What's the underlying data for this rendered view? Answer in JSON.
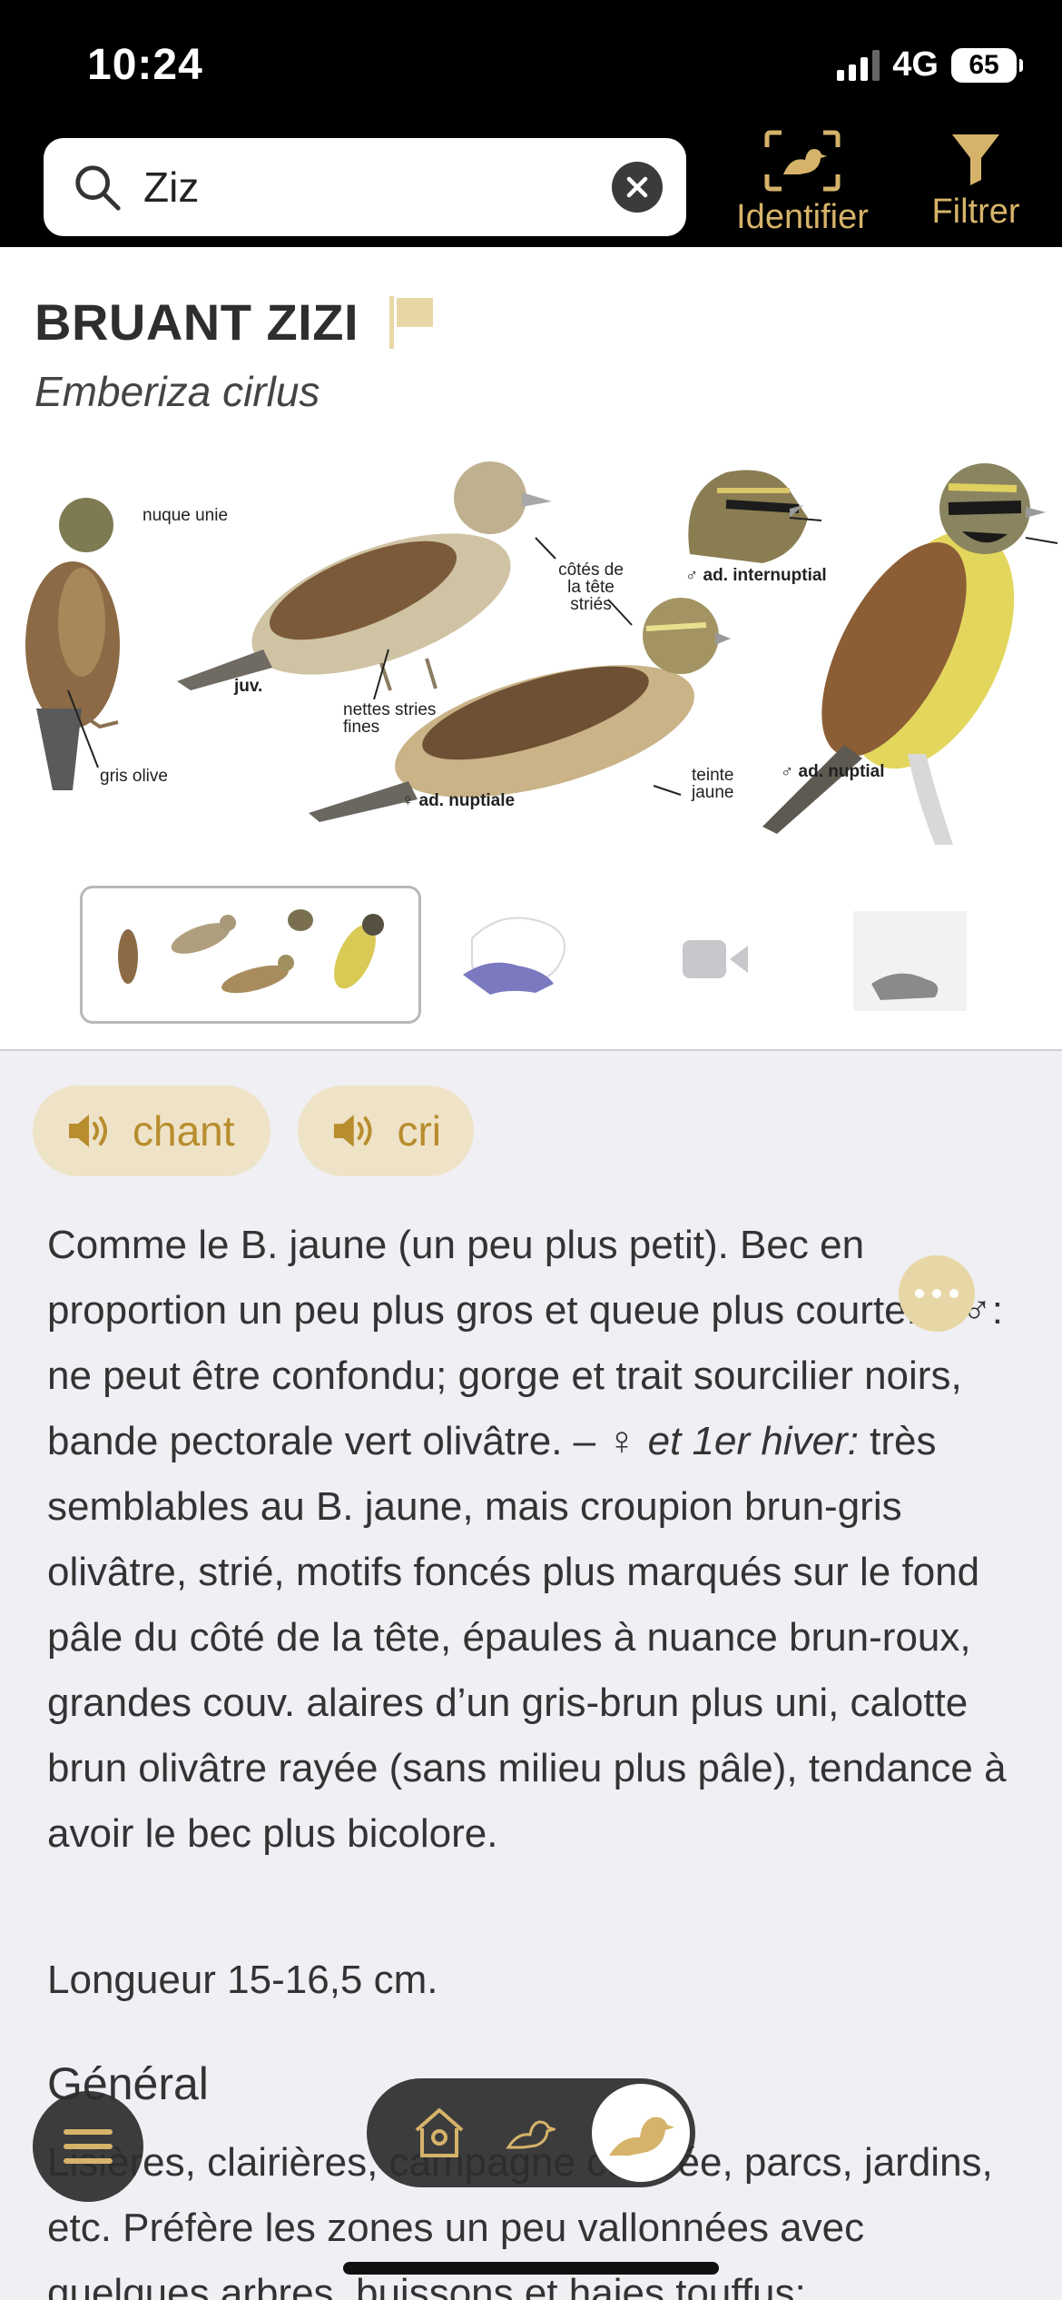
{
  "status": {
    "time": "10:24",
    "network": "4G",
    "battery": "65"
  },
  "search": {
    "value": "Ziz",
    "placeholder": ""
  },
  "toolbar": {
    "identify_label": "Identifier",
    "filter_label": "Filtrer"
  },
  "species": {
    "name": "BRUANT ZIZI",
    "latin": "Emberiza cirlus"
  },
  "plate_labels": {
    "nuque": "nuque unie",
    "gris_olive": "gris olive",
    "juv": "juv.",
    "nettes": "nettes stries fines",
    "cotes": "côtés de la tête striés",
    "internuptial": "♂ ad. internuptial",
    "nuptiale": "♀ ad. nuptiale",
    "teinte": "teinte jaune",
    "nuptial": "♂ ad. nuptial"
  },
  "sounds": {
    "chant": "chant",
    "cri": "cri"
  },
  "description": {
    "p1": "Comme le B. jaune (un peu plus petit). Bec en proportion un peu plus gros et queue plus courte. – ♂: ne peut être confondu; gorge et trait sourcilier noirs, bande pectorale vert olivâtre. – ♀ ",
    "p1_italic": "et 1er hiver:",
    "p1_end": " très semblables au B. jaune, mais croupion brun-gris olivâtre, strié, motifs foncés plus marqués sur le fond pâle du côté de la tête, épaules à nuance brun-roux, grandes couv. alaires d’un gris-brun plus uni, calotte brun olivâtre rayée (sans milieu plus pâle), tendance à avoir le bec plus bicolore."
  },
  "length": "Longueur 15-16,5 cm.",
  "general": {
    "title": "Général",
    "text": "Lisières, clairières, campagne cultivée, parcs, jardins, etc. Préfère les zones un peu vallonnées avec quelques arbres, buissons et haies touffus;"
  },
  "colors": {
    "accent": "#d6b36a",
    "accent_dark": "#b88d2e",
    "sound_bg": "#efe3c7"
  }
}
